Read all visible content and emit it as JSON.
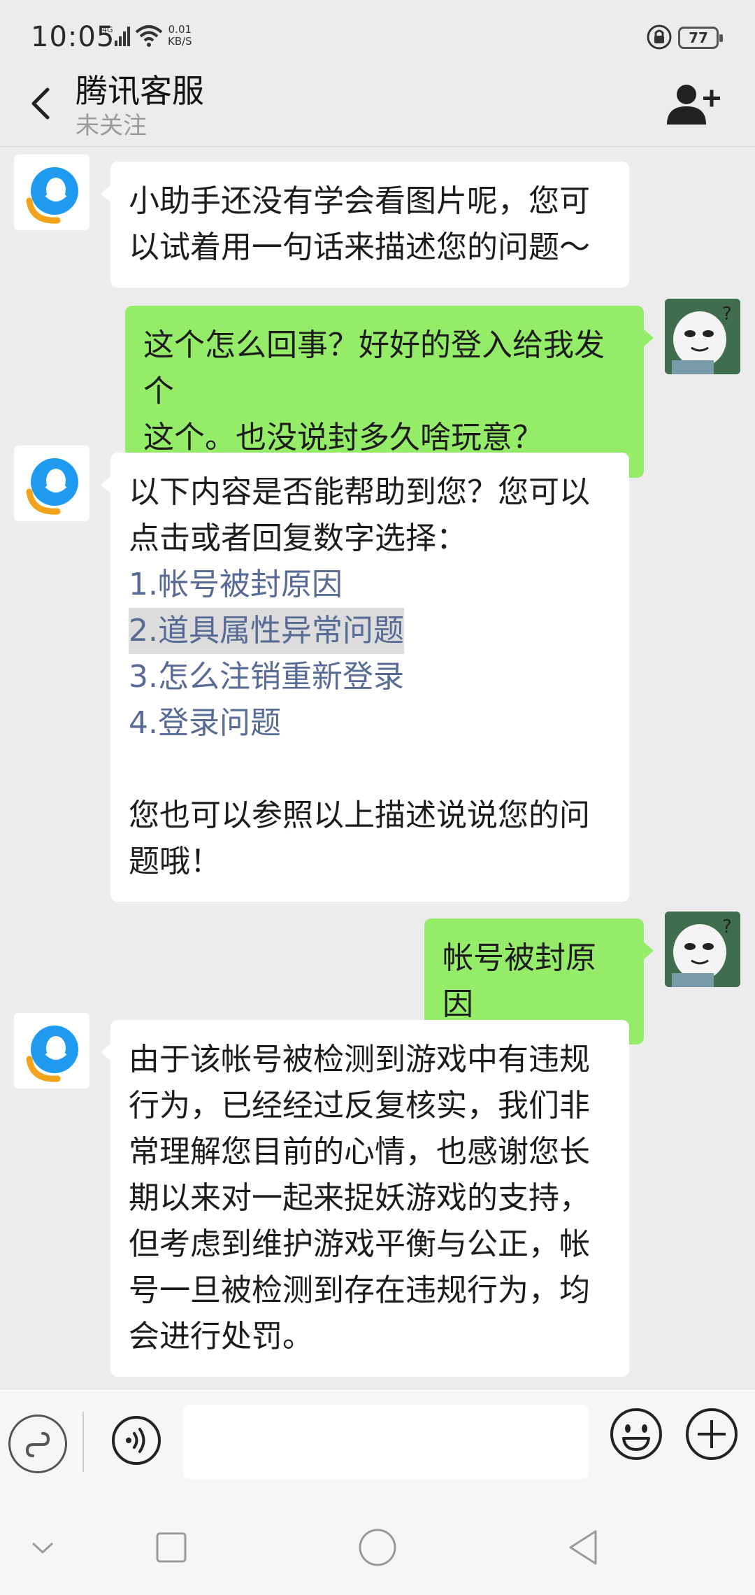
{
  "status_bar": {
    "time": "10:05",
    "network": "4G",
    "speed_value": "0.01",
    "speed_unit": "KB/S",
    "battery": "77"
  },
  "header": {
    "title": "腾讯客服",
    "subtitle": "未关注",
    "back_icon": "chevron-left-icon",
    "action_icon": "add-contact-icon"
  },
  "messages": [
    {
      "side": "left",
      "lines": [
        "小助手还没有学会看图片呢，您可",
        "以试着用一句话来描述您的问题～"
      ]
    },
    {
      "side": "right",
      "lines": [
        "这个怎么回事？好好的登入给我发个",
        "这个。也没说封多久啥玩意？"
      ]
    },
    {
      "side": "left",
      "intro": [
        "以下内容是否能帮助到您？您可以",
        "点击或者回复数字选择："
      ],
      "options": [
        "1.帐号被封原因",
        "2.道具属性异常问题",
        "3.怎么注销重新登录",
        "4.登录问题"
      ],
      "outro": [
        "您也可以参照以上描述说说您的问",
        "题哦！"
      ]
    },
    {
      "side": "right",
      "lines": [
        "帐号被封原因"
      ]
    },
    {
      "side": "left",
      "lines": [
        "由于该帐号被检测到游戏中有违规",
        "行为，已经经过反复核实，我们非",
        "常理解您目前的心情，也感谢您长",
        "期以来对一起来捉妖游戏的支持，",
        "但考虑到维护游戏平衡与公正，帐",
        "号一旦被检测到存在违规行为，均",
        "会进行处罚。"
      ]
    }
  ],
  "input_bar": {
    "placeholder": "",
    "left_icon": "mini-program-icon",
    "voice_icon": "voice-icon",
    "emoji_icon": "emoji-icon",
    "plus_icon": "plus-icon"
  },
  "nav_bar": {
    "icons": [
      "collapse-icon",
      "recent-apps-icon",
      "home-icon",
      "back-icon"
    ]
  },
  "colors": {
    "background": "#ececec",
    "bubble_self": "#95ec69",
    "bubble_other": "#ffffff",
    "link": "#576b95",
    "qq_blue": "#1e9af0",
    "qq_orange": "#f3a31b"
  }
}
